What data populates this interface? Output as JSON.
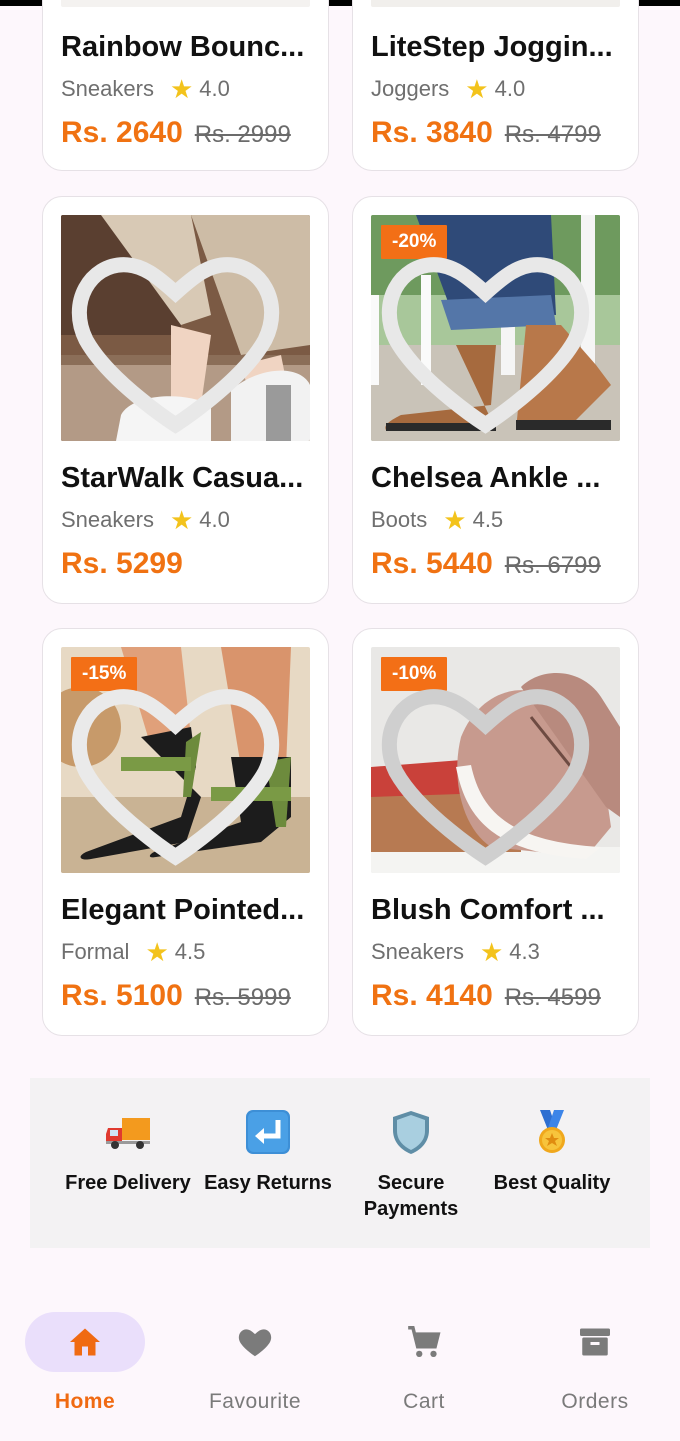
{
  "products": [
    {
      "name": "Rainbow Bounc...",
      "category": "Sneakers",
      "rating": "4.0",
      "price": "Rs. 2640",
      "old_price": "Rs. 2999"
    },
    {
      "name": "LiteStep Joggin...",
      "category": "Joggers",
      "rating": "4.0",
      "price": "Rs. 3840",
      "old_price": "Rs. 4799"
    },
    {
      "name": "StarWalk Casua...",
      "category": "Sneakers",
      "rating": "4.0",
      "price": "Rs. 5299",
      "old_price": ""
    },
    {
      "name": "Chelsea Ankle ...",
      "category": "Boots",
      "rating": "4.5",
      "price": "Rs. 5440",
      "old_price": "Rs. 6799",
      "discount": "-20%"
    },
    {
      "name": "Elegant Pointed...",
      "category": "Formal",
      "rating": "4.5",
      "price": "Rs. 5100",
      "old_price": "Rs. 5999",
      "discount": "-15%"
    },
    {
      "name": "Blush Comfort ...",
      "category": "Sneakers",
      "rating": "4.3",
      "price": "Rs. 4140",
      "old_price": "Rs. 4599",
      "discount": "-10%"
    }
  ],
  "features": [
    {
      "label": "Free Delivery",
      "icon": "delivery-truck-icon"
    },
    {
      "label": "Easy Returns",
      "icon": "return-arrow-icon"
    },
    {
      "label": "Secure Payments",
      "icon": "shield-icon"
    },
    {
      "label": "Best Quality",
      "icon": "medal-icon"
    }
  ],
  "nav": [
    {
      "label": "Home",
      "icon": "home-icon",
      "active": true
    },
    {
      "label": "Favourite",
      "icon": "heart-icon",
      "active": false
    },
    {
      "label": "Cart",
      "icon": "cart-icon",
      "active": false
    },
    {
      "label": "Orders",
      "icon": "archive-icon",
      "active": false
    }
  ],
  "colors": {
    "accent": "#f07212",
    "badge": "#f36f16",
    "active_pill": "#eadffb",
    "star": "#f3c31c"
  }
}
